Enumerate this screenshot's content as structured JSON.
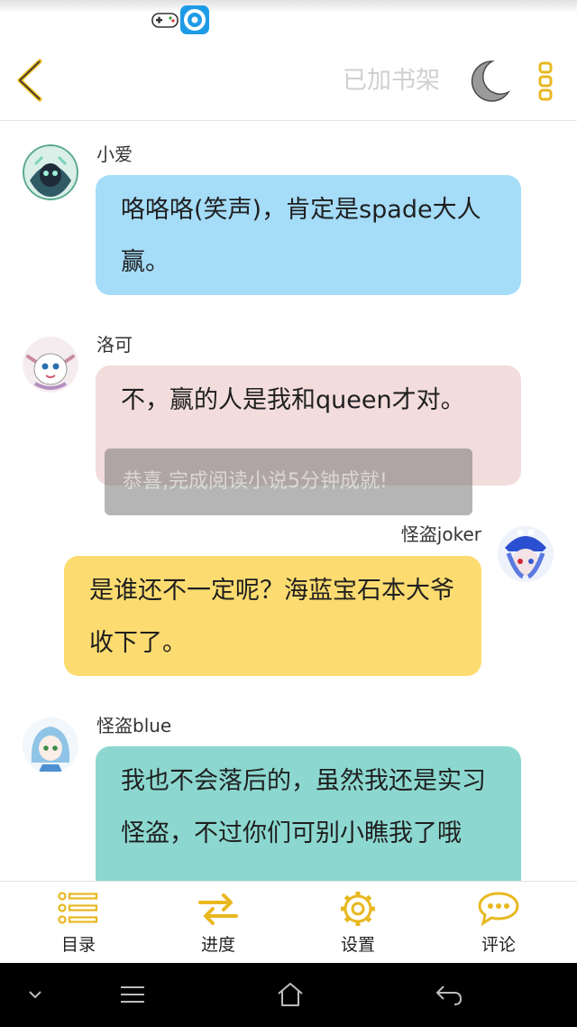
{
  "header": {
    "shelf_label": "已加书架"
  },
  "messages": [
    {
      "sender": "小爱",
      "text": "咯咯咯(笑声)，肯定是spade大人赢。"
    },
    {
      "sender": "洛可",
      "text": "不，赢的人是我和queen才对。"
    },
    {
      "sender": "怪盗joker",
      "text": "是谁还不一定呢？海蓝宝石本大爷收下了。"
    },
    {
      "sender": "怪盗blue",
      "text": "我也不会落后的，虽然我还是实习怪盗，不过你们可别小瞧我了哦"
    }
  ],
  "toast": "恭喜,完成阅读小说5分钟成就!",
  "toolbar": {
    "catalog": "目录",
    "progress": "进度",
    "settings": "设置",
    "comments": "评论"
  },
  "colors": {
    "accent": "#e8b820",
    "bubble_blue": "#a5dcf8",
    "bubble_pink": "#f2dcdc",
    "bubble_yellow": "#fcdc70",
    "bubble_teal": "#8cd8d0"
  }
}
